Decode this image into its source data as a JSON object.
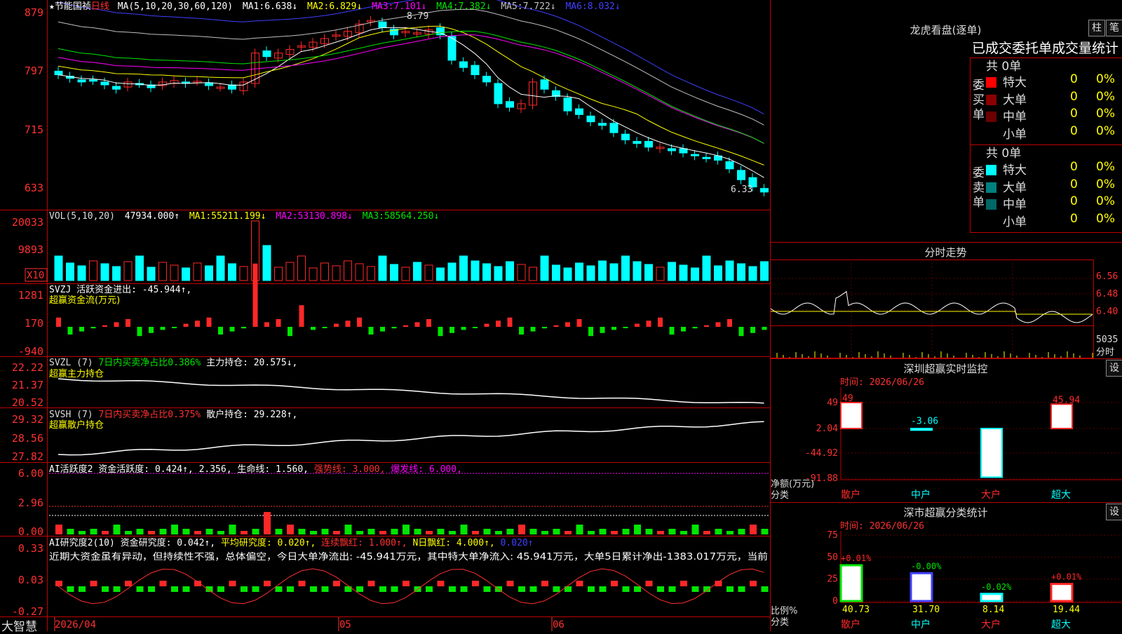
{
  "stock": {
    "name": "节能国祯",
    "period": "日线",
    "star": "★"
  },
  "colors": {
    "up": "#ff2828",
    "down": "#00ffff",
    "green": "#00e600",
    "frame": "#c00000"
  },
  "main": {
    "ma_header": "MA(5,10,20,30,60,120)",
    "ma": [
      {
        "label": "MA1:",
        "value": "6.638↓",
        "color": "#ffffff"
      },
      {
        "label": "MA2:",
        "value": "6.829↓",
        "color": "#ffff00"
      },
      {
        "label": "MA3:",
        "value": "7.101↓",
        "color": "#ff00ff"
      },
      {
        "label": "MA4:",
        "value": "7.382↓",
        "color": "#00e600"
      },
      {
        "label": "MA5:",
        "value": "7.722↓",
        "color": "#c0c0c0"
      },
      {
        "label": "MA6:",
        "value": "8.032↓",
        "color": "#4040ff"
      }
    ],
    "y_ticks": [
      "879",
      "797",
      "715",
      "633"
    ],
    "high_label": "8.79",
    "low_label": "6.33"
  },
  "vol": {
    "header": "VOL(5,10,20)",
    "value": "47934.000↑",
    "ma": [
      {
        "label": "MA1:",
        "value": "55211.199↓",
        "color": "#ffff00"
      },
      {
        "label": "MA2:",
        "value": "53130.898↓",
        "color": "#ff00ff"
      },
      {
        "label": "MA3:",
        "value": "58564.250↓",
        "color": "#00e600"
      }
    ],
    "y_ticks": [
      "20033",
      "9893"
    ],
    "unit": "X10"
  },
  "svzj": {
    "header": "SVZJ  活跃资金进出: -45.944↑,",
    "sub": "超赢资金流(万元)",
    "y_ticks": [
      "1281",
      "170",
      "-940"
    ]
  },
  "svzl": {
    "header_a": "SVZL (7) ",
    "header_b": "7日内买卖净占比0.386%",
    "header_c": " 主力持仓: 20.575↓,",
    "sub": "超赢主力持仓",
    "y_ticks": [
      "22.22",
      "21.37",
      "20.52"
    ]
  },
  "svsh": {
    "header_a": "SVSH (7) ",
    "header_b": "7日内买卖净占比0.375%",
    "header_c": " 散户持仓: 29.228↑,",
    "sub": "超赢散户持仓",
    "y_ticks": [
      "29.32",
      "28.56",
      "27.82"
    ]
  },
  "ai1": {
    "a": "AI活跃度2 资金活跃度: 0.424↑, 2.356,",
    "b": " 生命线: 1.560,",
    "c": " 强势线: 3.000,",
    "d": " 爆发线: 6.000,",
    "y_ticks": [
      "6.00",
      "2.96",
      "0.00"
    ]
  },
  "ai2": {
    "a": "AI研究度2(10) 资金研究度: 0.042↑,",
    "b": " 平均研究度: 0.020↑,",
    "c": " 连续飘红: 1.000↑,",
    "d": " N日飘红: 4.000↑,",
    "e": " 0.020↑",
    "comment": "近期大资金虽有异动，但持续性不强，总体偏空，今日大单净流出: -45.941万元，其中特大单净流入: 45.941万元，大单5日累计净出-1383.017万元，当前",
    "y_ticks": [
      "0.33",
      "0.03",
      "-0.27"
    ]
  },
  "xaxis": {
    "labels": [
      "2026/04",
      "05",
      "06"
    ]
  },
  "brand": "大智慧",
  "side": {
    "title": "龙虎看盘(逐单)",
    "btn_a": "柱",
    "btn_b": "笔",
    "tabs": "已成交委托单成交量统计",
    "buy_label": "委买单",
    "sell_label": "委卖单",
    "buy_total": "共 0单",
    "sell_total": "共 0单",
    "buy_rows": [
      {
        "name": "特大",
        "count": "0",
        "pct": "0%",
        "color": "#ff0000"
      },
      {
        "name": "大单",
        "count": "0",
        "pct": "0%",
        "color": "#8b0000"
      },
      {
        "name": "中单",
        "count": "0",
        "pct": "0%",
        "color": "#6b0000"
      },
      {
        "name": "小单",
        "count": "0",
        "pct": "0%",
        "color": "#000000"
      }
    ],
    "sell_rows": [
      {
        "name": "特大",
        "count": "0",
        "pct": "0%",
        "color": "#00ffff"
      },
      {
        "name": "大单",
        "count": "0",
        "pct": "0%",
        "color": "#008080"
      },
      {
        "name": "中单",
        "count": "0",
        "pct": "0%",
        "color": "#006666"
      },
      {
        "name": "小单",
        "count": "0",
        "pct": "0%",
        "color": "#000000"
      }
    ],
    "intraday_title": "分时走势",
    "intraday_ticks": [
      "6.56",
      "6.48",
      "6.40",
      "5035"
    ],
    "intraday_unit": "分时",
    "monitor_title": "深圳超赢实时监控",
    "set1": "设",
    "monitor_time": "时间: 2026/06/26",
    "monitor_ticks": [
      "49",
      "2.04",
      "-44.92",
      "-91.88"
    ],
    "monitor_ylabel": "净额(万元)",
    "monitor_xlabel": "分类",
    "stat_title": "深市超赢分类统计",
    "set2": "设",
    "stat_time": "时间: 2026/06/26",
    "stat_ticks": [
      "75",
      "50",
      "25",
      "0"
    ],
    "stat_ylabel": "比例%",
    "stat_xlabel": "分类",
    "categories": [
      "散户",
      "中户",
      "大户",
      "超大"
    ]
  },
  "monitor_chart": {
    "type": "bar",
    "categories": [
      "散户",
      "中户",
      "大户",
      "超大"
    ],
    "values": [
      49,
      -3.06,
      -91.88,
      45.94
    ],
    "labels": [
      "49",
      "-3.06",
      "-91.88",
      "45.94"
    ]
  },
  "stat_chart": {
    "type": "bar",
    "categories": [
      "散户",
      "中户",
      "大户",
      "超大"
    ],
    "values": [
      40.73,
      31.7,
      8.14,
      19.44
    ],
    "changes": [
      "+0.01%",
      "-0.00%",
      "-0.02%",
      "+0.01%"
    ],
    "labels": [
      "40.73",
      "31.70",
      "8.14",
      "19.44"
    ]
  }
}
